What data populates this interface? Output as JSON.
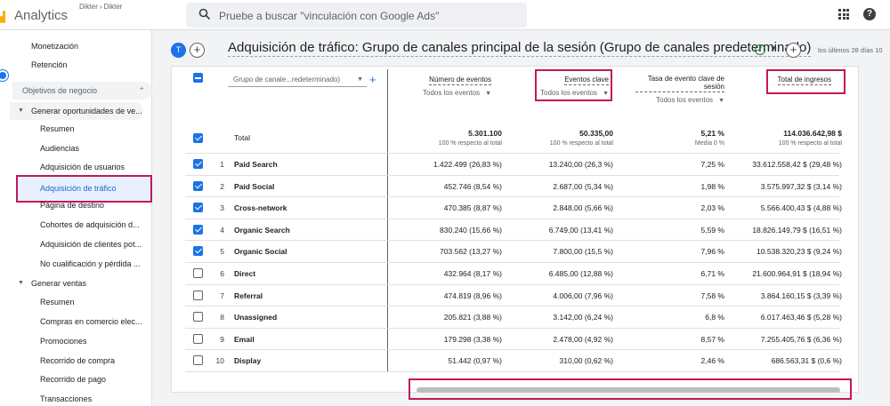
{
  "topbar": {
    "app_name": "Analytics",
    "account_path": [
      "Dikter",
      "Dikter"
    ],
    "search_placeholder": "Pruebe a buscar \"vinculación con Google Ads\""
  },
  "sidebar": {
    "top_items": [
      "Monetización",
      "Retención"
    ],
    "group_label": "Objetivos de negocio",
    "section1_label": "Generar oportunidades de ve...",
    "section1_items": [
      "Resumen",
      "Audiencias",
      "Adquisición de usuarios",
      "Adquisición de tráfico",
      "Página de destino",
      "Cohortes de adquisición d...",
      "Adquisición de clientes pot...",
      "No cualificación y pérdida ..."
    ],
    "section2_label": "Generar ventas",
    "section2_items": [
      "Resumen",
      "Compras en comercio elec...",
      "Promociones",
      "Recorrido de compra",
      "Recorrido de pago",
      "Transacciones"
    ],
    "active_item": "Adquisición de tráfico"
  },
  "header": {
    "avatar_letter": "T",
    "title": "Adquisición de tráfico: Grupo de canales principal de la sesión (Grupo de canales predeterminado)",
    "date_range": "los últimos 28 días  10"
  },
  "table": {
    "dimension_select": "Grupo de canale...redeterminado)",
    "columns": [
      {
        "label": "Número de eventos",
        "sub": "Todos los eventos"
      },
      {
        "label": "Eventos clave",
        "sub": "Todos los eventos"
      },
      {
        "label": "Tasa de evento clave de sesión",
        "sub": "Todos los eventos"
      },
      {
        "label": "Total de ingresos",
        "sub": ""
      }
    ],
    "totals": {
      "label": "Total",
      "values": [
        "5.301.100",
        "50.335,00",
        "5,21 %",
        "114.036.642,98 $"
      ],
      "subs": [
        "100 % respecto al total",
        "100 % respecto al total",
        "Media 0 %",
        "100 % respecto al total"
      ]
    },
    "rows": [
      {
        "idx": "1",
        "name": "Paid Search",
        "checked": true,
        "values": [
          "1.422.499 (26,83 %)",
          "13.240,00 (26,3 %)",
          "7,25 %",
          "33.612.558,42 $ (29,48 %)"
        ]
      },
      {
        "idx": "2",
        "name": "Paid Social",
        "checked": true,
        "values": [
          "452.746 (8,54 %)",
          "2.687,00 (5,34 %)",
          "1,98 %",
          "3.575.997,32 $ (3,14 %)"
        ]
      },
      {
        "idx": "3",
        "name": "Cross-network",
        "checked": true,
        "values": [
          "470.385 (8,87 %)",
          "2.848,00 (5,66 %)",
          "2,03 %",
          "5.566.400,43 $ (4,88 %)"
        ]
      },
      {
        "idx": "4",
        "name": "Organic Search",
        "checked": true,
        "values": [
          "830.240 (15,66 %)",
          "6.749,00 (13,41 %)",
          "5,59 %",
          "18.826.149,79 $ (16,51 %)"
        ]
      },
      {
        "idx": "5",
        "name": "Organic Social",
        "checked": true,
        "values": [
          "703.562 (13,27 %)",
          "7.800,00 (15,5 %)",
          "7,96 %",
          "10.538.320,23 $ (9,24 %)"
        ]
      },
      {
        "idx": "6",
        "name": "Direct",
        "checked": false,
        "values": [
          "432.964 (8,17 %)",
          "6.485,00 (12,88 %)",
          "6,71 %",
          "21.600.964,91 $ (18,94 %)"
        ]
      },
      {
        "idx": "7",
        "name": "Referral",
        "checked": false,
        "values": [
          "474.819 (8,96 %)",
          "4.006,00 (7,96 %)",
          "7,58 %",
          "3.864.160,15 $ (3,39 %)"
        ]
      },
      {
        "idx": "8",
        "name": "Unassigned",
        "checked": false,
        "values": [
          "205.821 (3,88 %)",
          "3.142,00 (6,24 %)",
          "6,8 %",
          "6.017.463,46 $ (5,28 %)"
        ]
      },
      {
        "idx": "9",
        "name": "Email",
        "checked": false,
        "values": [
          "179.298 (3,38 %)",
          "2.478,00 (4,92 %)",
          "8,57 %",
          "7.255.405,76 $ (6,36 %)"
        ]
      },
      {
        "idx": "10",
        "name": "Display",
        "checked": false,
        "values": [
          "51.442 (0,97 %)",
          "310,00 (0,62 %)",
          "2,46 %",
          "686.563,31 $ (0,6 %)"
        ]
      }
    ]
  },
  "colors": {
    "accent": "#1a73e8",
    "highlight": "#c2185b"
  }
}
